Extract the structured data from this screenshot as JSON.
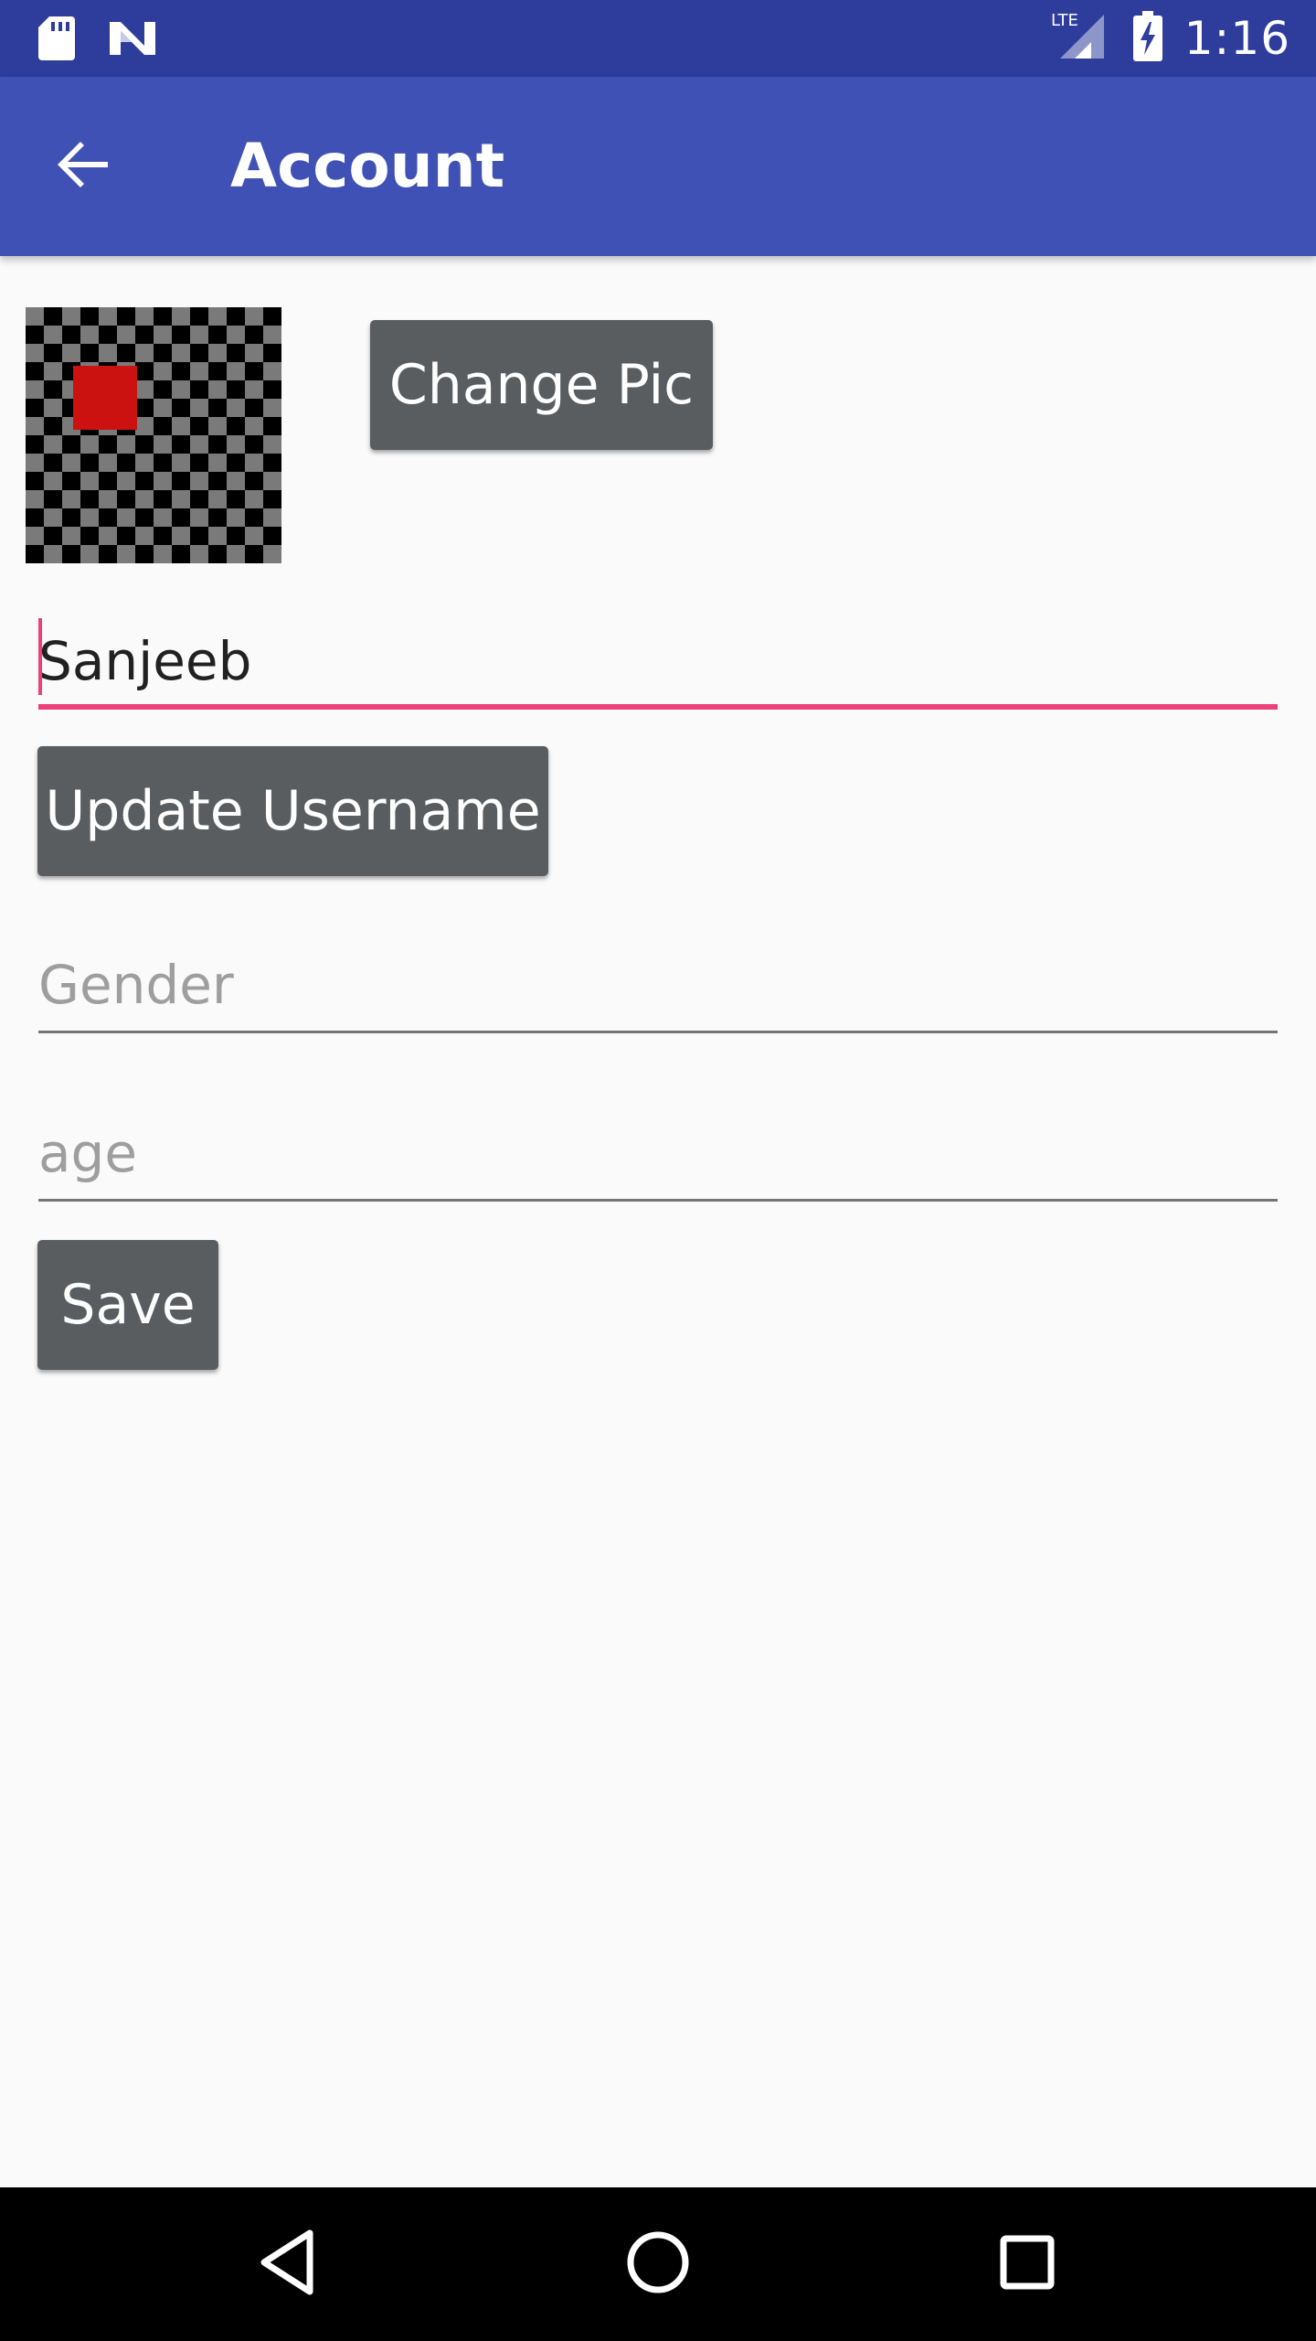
{
  "status_bar": {
    "time": "1:16",
    "network": "LTE",
    "icons": [
      "sd-card-icon",
      "n-logo-icon",
      "lte-signal-icon",
      "battery-charging-icon"
    ]
  },
  "toolbar": {
    "title": "Account",
    "back_icon": "arrow-back-icon"
  },
  "profile": {
    "change_pic_label": "Change Pic"
  },
  "form": {
    "username_value": "Sanjeeb",
    "update_username_label": "Update Username",
    "gender_placeholder": "Gender",
    "age_placeholder": "age",
    "save_label": "Save"
  },
  "nav_bar": {
    "icons": [
      "back-triangle-icon",
      "home-circle-icon",
      "recents-square-icon"
    ]
  },
  "colors": {
    "status_bar": "#2e3d9c",
    "toolbar": "#3f51b5",
    "accent": "#ec407a",
    "button": "#595d60",
    "background": "#fafafa"
  }
}
